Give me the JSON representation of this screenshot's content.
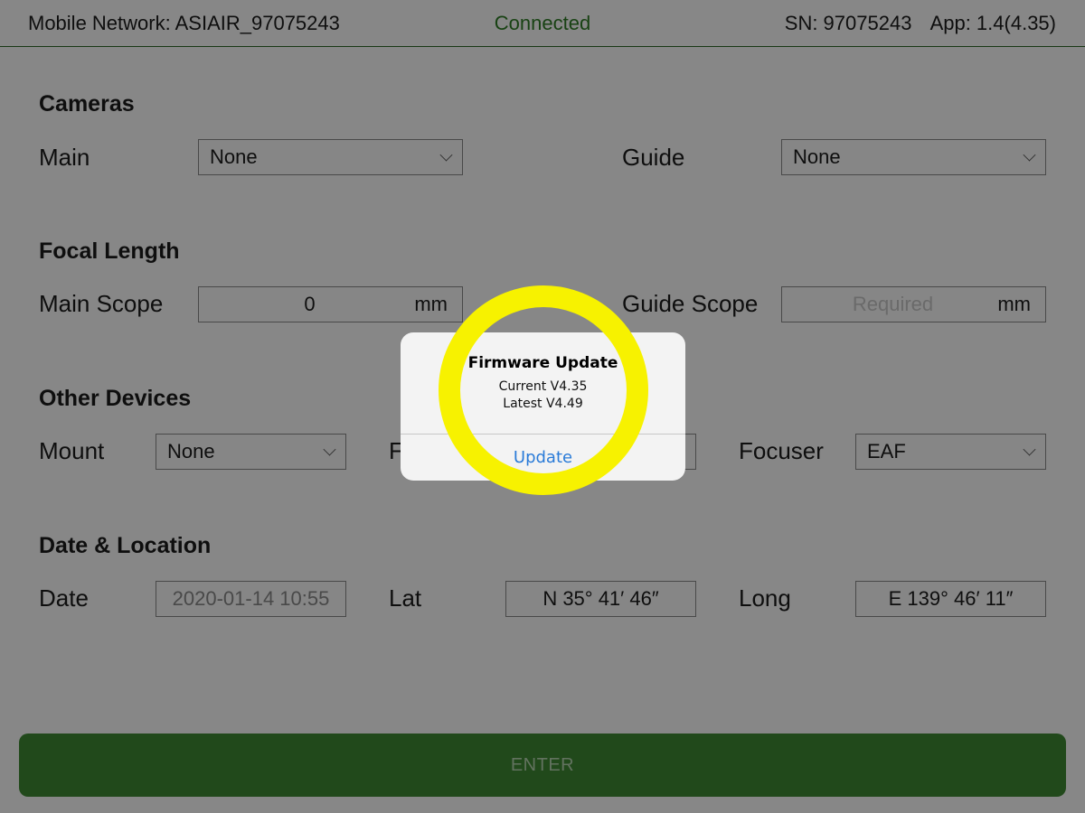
{
  "status_bar": {
    "network": "Mobile Network: ASIAIR_97075243",
    "connection": "Connected",
    "serial": "SN: 97075243",
    "app_version": "App: 1.4(4.35)"
  },
  "cameras": {
    "title": "Cameras",
    "main_label": "Main",
    "main_value": "None",
    "guide_label": "Guide",
    "guide_value": "None"
  },
  "focal_length": {
    "title": "Focal Length",
    "main_label": "Main Scope",
    "main_value": "0",
    "main_unit": "mm",
    "guide_label": "Guide Scope",
    "guide_placeholder": "Required",
    "guide_unit": "mm"
  },
  "other_devices": {
    "title": "Other Devices",
    "mount_label": "Mount",
    "mount_value": "None",
    "filter_label_partial": "F",
    "focuser_label": "Focuser",
    "focuser_value": "EAF"
  },
  "date_location": {
    "title": "Date & Location",
    "date_label": "Date",
    "date_value": "2020-01-14 10:55",
    "lat_label": "Lat",
    "lat_value": "N 35° 41′ 46″",
    "long_label": "Long",
    "long_value": "E 139° 46′ 11″"
  },
  "enter_button": "ENTER",
  "dialog": {
    "title": "Firmware Update",
    "current": "Current V4.35",
    "latest": "Latest V4.49",
    "button": "Update"
  },
  "colors": {
    "connected": "#2e7d25",
    "enter_button": "#3f8a33",
    "highlight_ring": "#f7f200",
    "dialog_button": "#2a7bd8"
  }
}
